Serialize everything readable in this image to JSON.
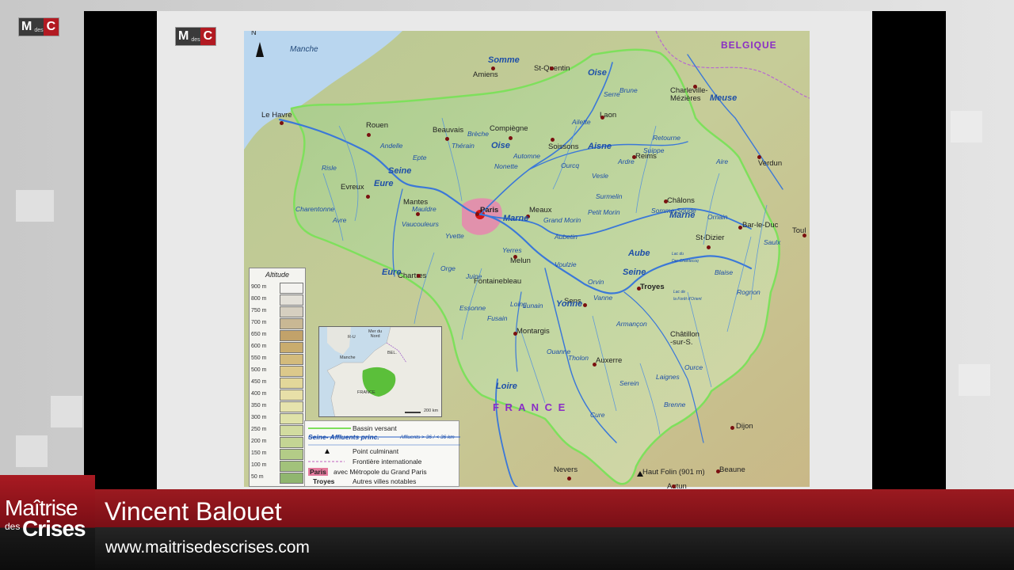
{
  "channel_logo": {
    "m": "M",
    "des": "des",
    "c": "C"
  },
  "slide_logo": {
    "m": "M",
    "des": "des",
    "c": "C"
  },
  "map": {
    "north_label": "N",
    "seas": [
      {
        "name": "Manche",
        "key": "manche"
      }
    ],
    "countries": [
      {
        "key": "belgique",
        "name": "BELGIQUE"
      },
      {
        "key": "france",
        "name": "F R A N C E"
      }
    ],
    "cities": [
      {
        "key": "amiens",
        "name": "Amiens"
      },
      {
        "key": "st-quentin",
        "name": "St-Quentin"
      },
      {
        "key": "le-havre",
        "name": "Le Havre"
      },
      {
        "key": "rouen",
        "name": "Rouen"
      },
      {
        "key": "beauvais",
        "name": "Beauvais"
      },
      {
        "key": "compiegne",
        "name": "Compiègne"
      },
      {
        "key": "laon",
        "name": "Laon"
      },
      {
        "key": "charleville",
        "name": "Charleville-\nMézières"
      },
      {
        "key": "soissons",
        "name": "Soissons"
      },
      {
        "key": "reims",
        "name": "Reims"
      },
      {
        "key": "verdun",
        "name": "Verdun"
      },
      {
        "key": "evreux",
        "name": "Evreux"
      },
      {
        "key": "mantes",
        "name": "Mantes"
      },
      {
        "key": "paris",
        "name": "Paris"
      },
      {
        "key": "meaux",
        "name": "Meaux"
      },
      {
        "key": "chalons",
        "name": "Châlons"
      },
      {
        "key": "bar-le-duc",
        "name": "Bar-le-Duc"
      },
      {
        "key": "toul",
        "name": "Toul"
      },
      {
        "key": "st-dizier",
        "name": "St-Dizier"
      },
      {
        "key": "melun",
        "name": "Melun"
      },
      {
        "key": "chartres",
        "name": "Chartres"
      },
      {
        "key": "fontainebleau",
        "name": "Fontainebleau"
      },
      {
        "key": "troyes",
        "name": "Troyes"
      },
      {
        "key": "sens",
        "name": "Sens"
      },
      {
        "key": "montargis",
        "name": "Montargis"
      },
      {
        "key": "auxerre",
        "name": "Auxerre"
      },
      {
        "key": "chatillon",
        "name": "Châtillon\n-sur-S."
      },
      {
        "key": "dijon",
        "name": "Dijon"
      },
      {
        "key": "nevers",
        "name": "Nevers"
      },
      {
        "key": "beaune",
        "name": "Beaune"
      },
      {
        "key": "autun",
        "name": "Autun"
      },
      {
        "key": "haut-folin",
        "name": "Haut Folin (901 m)"
      }
    ],
    "rivers": [
      {
        "key": "somme",
        "name": "Somme"
      },
      {
        "key": "oise-n",
        "name": "Oise"
      },
      {
        "key": "oise-s",
        "name": "Oise"
      },
      {
        "key": "aisne",
        "name": "Aisne"
      },
      {
        "key": "seine-w",
        "name": "Seine"
      },
      {
        "key": "eure-n",
        "name": "Eure"
      },
      {
        "key": "eure-s",
        "name": "Eure"
      },
      {
        "key": "marne-w",
        "name": "Marne"
      },
      {
        "key": "marne-e",
        "name": "Marne"
      },
      {
        "key": "aube",
        "name": "Aube"
      },
      {
        "key": "seine-e",
        "name": "Seine"
      },
      {
        "key": "yonne",
        "name": "Yonne"
      },
      {
        "key": "loire",
        "name": "Loire"
      },
      {
        "key": "meuse",
        "name": "Meuse"
      },
      {
        "key": "risle",
        "name": "Risle"
      },
      {
        "key": "grand-morin",
        "name": "Grand Morin"
      },
      {
        "key": "petit-morin",
        "name": "Petit Morin"
      },
      {
        "key": "aubetin",
        "name": "Aubetin"
      },
      {
        "key": "yerres",
        "name": "Yerres"
      },
      {
        "key": "loing",
        "name": "Loing"
      },
      {
        "key": "essonne",
        "name": "Essonne"
      },
      {
        "key": "armancon",
        "name": "Armançon"
      },
      {
        "key": "vanne",
        "name": "Vanne"
      },
      {
        "key": "orvin",
        "name": "Orvin"
      },
      {
        "key": "ourcq",
        "name": "Ourcq"
      },
      {
        "key": "vesle",
        "name": "Vesle"
      },
      {
        "key": "aire",
        "name": "Aire"
      },
      {
        "key": "ornain",
        "name": "Ornain"
      },
      {
        "key": "saulx",
        "name": "Saulx"
      },
      {
        "key": "blaise",
        "name": "Blaise"
      },
      {
        "key": "rognon",
        "name": "Rognon"
      },
      {
        "key": "ailette",
        "name": "Ailette"
      },
      {
        "key": "serre",
        "name": "Serre"
      },
      {
        "key": "brune",
        "name": "Brune"
      },
      {
        "key": "retourne",
        "name": "Retourne"
      },
      {
        "key": "suippe",
        "name": "Suippe"
      },
      {
        "key": "andelle",
        "name": "Andelle"
      },
      {
        "key": "epte",
        "name": "Epte"
      },
      {
        "key": "breche",
        "name": "Brèche"
      },
      {
        "key": "therain",
        "name": "Thérain"
      },
      {
        "key": "nonette",
        "name": "Nonette"
      },
      {
        "key": "automne",
        "name": "Automne"
      },
      {
        "key": "yvette",
        "name": "Yvette"
      },
      {
        "key": "orge",
        "name": "Orge"
      },
      {
        "key": "juine",
        "name": "Juine"
      },
      {
        "key": "voulzie",
        "name": "Voulzie"
      },
      {
        "key": "ouanne",
        "name": "Ouanne"
      },
      {
        "key": "cure",
        "name": "Cure"
      },
      {
        "key": "serein",
        "name": "Serein"
      },
      {
        "key": "ource",
        "name": "Ource"
      },
      {
        "key": "laignes",
        "name": "Laignes"
      },
      {
        "key": "brenne",
        "name": "Brenne"
      },
      {
        "key": "tholon",
        "name": "Tholon"
      },
      {
        "key": "lunain",
        "name": "Lunain"
      },
      {
        "key": "fusain",
        "name": "Fusain"
      },
      {
        "key": "mauldre",
        "name": "Mauldre"
      },
      {
        "key": "avre",
        "name": "Avre"
      },
      {
        "key": "charentonne",
        "name": "Charentonne"
      },
      {
        "key": "vaucouleurs",
        "name": "Vaucouleurs"
      },
      {
        "key": "somme-soude",
        "name": "Somme-Soude"
      },
      {
        "key": "surmelin",
        "name": "Surmelin"
      },
      {
        "key": "ardre",
        "name": "Ardre"
      },
      {
        "key": "lac-der",
        "name": "Lac du\nDer-Chantecoq"
      },
      {
        "key": "lac-foret",
        "name": "Lac de\nla Forêt d'Orient"
      }
    ],
    "altitude_legend": {
      "title": "Altitude",
      "levels": [
        {
          "label": "900 m",
          "color": "#f3f2ef"
        },
        {
          "label": "800 m",
          "color": "#e3e0d8"
        },
        {
          "label": "750 m",
          "color": "#d6cfc0"
        },
        {
          "label": "700 m",
          "color": "#c9b894"
        },
        {
          "label": "650 m",
          "color": "#c2a26a"
        },
        {
          "label": "600 m",
          "color": "#c9ac6e"
        },
        {
          "label": "550 m",
          "color": "#d3bb7c"
        },
        {
          "label": "500 m",
          "color": "#dcc98b"
        },
        {
          "label": "450 m",
          "color": "#e3d79a"
        },
        {
          "label": "400 m",
          "color": "#e8e0a8"
        },
        {
          "label": "350 m",
          "color": "#e6e3ad"
        },
        {
          "label": "300 m",
          "color": "#dfe2a9"
        },
        {
          "label": "250 m",
          "color": "#d2dca0"
        },
        {
          "label": "200 m",
          "color": "#c4d594"
        },
        {
          "label": "150 m",
          "color": "#b3cc87"
        },
        {
          "label": "100 m",
          "color": "#a2c27b"
        },
        {
          "label": "50 m",
          "color": "#90b66f"
        }
      ]
    },
    "inset": {
      "mer_du_nord": "Mer du\nNord",
      "ru": "R-U",
      "manche": "Manche",
      "bel": "BEL.",
      "france": "FRANCE",
      "scale": "200 km"
    },
    "symbol_legend": {
      "bassin": "Bassin versant",
      "seine_affluents": "Seine- Affluents princ.",
      "seine_affluents_detail": "Affluents > 36 / < 36 km",
      "point_culminant": "Point culminant",
      "frontiere": "Frontière internationale",
      "paris_sample": "Paris",
      "paris_text": "avec Métropole du Grand  Paris",
      "troyes_sample": "Troyes",
      "troyes_text": "Autres villes notables"
    }
  },
  "lower_third": {
    "show_logo": {
      "line1": "Maîtrise",
      "line2": "des",
      "line3": "Crises"
    },
    "guest_name": "Vincent Balouet",
    "website": "www.maitrisedescrises.com"
  }
}
